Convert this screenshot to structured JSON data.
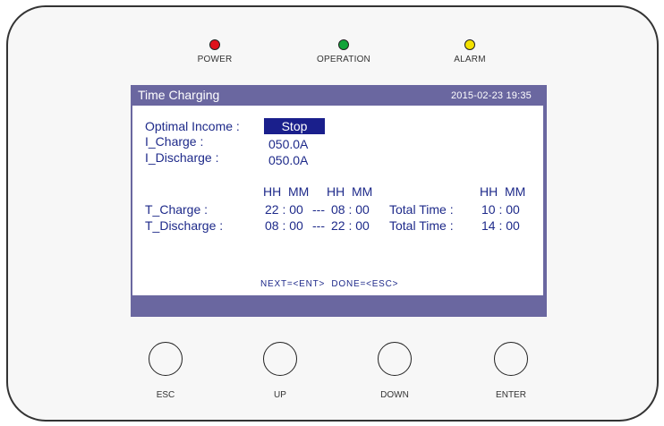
{
  "leds": [
    {
      "label": "POWER",
      "color": "#e0121b"
    },
    {
      "label": "OPERATION",
      "color": "#11a43a"
    },
    {
      "label": "ALARM",
      "color": "#f4e200"
    }
  ],
  "screen": {
    "title": "Time Charging",
    "datetime": "2015-02-23  19:35",
    "optimal_income_label": "Optimal Income :",
    "optimal_income_value": "Stop",
    "i_charge_label": "I_Charge :",
    "i_charge_value": "050.0A",
    "i_discharge_label": "I_Discharge :",
    "i_discharge_value": "050.0A",
    "header_start": "HH  MM",
    "header_end": "HH  MM",
    "header_total": "HH  MM",
    "t_charge_label": "T_Charge :",
    "t_charge_start": "22 : 00",
    "t_charge_sep": "---",
    "t_charge_end": "08 : 00",
    "t_charge_total_label": "Total Time :",
    "t_charge_total": "10 : 00",
    "t_discharge_label": "T_Discharge :",
    "t_discharge_start": "08 : 00",
    "t_discharge_sep": "---",
    "t_discharge_end": "22 : 00",
    "t_discharge_total_label": "Total Time :",
    "t_discharge_total": "14 : 00",
    "footer_hint": "NEXT=<ENT>  DONE=<ESC>"
  },
  "buttons": [
    {
      "label": "ESC"
    },
    {
      "label": "UP"
    },
    {
      "label": "DOWN"
    },
    {
      "label": "ENTER"
    }
  ],
  "colors": {
    "screen_frame": "#6a67a0",
    "text": "#1e2a8a",
    "highlight_bg": "#1a1f8c"
  }
}
